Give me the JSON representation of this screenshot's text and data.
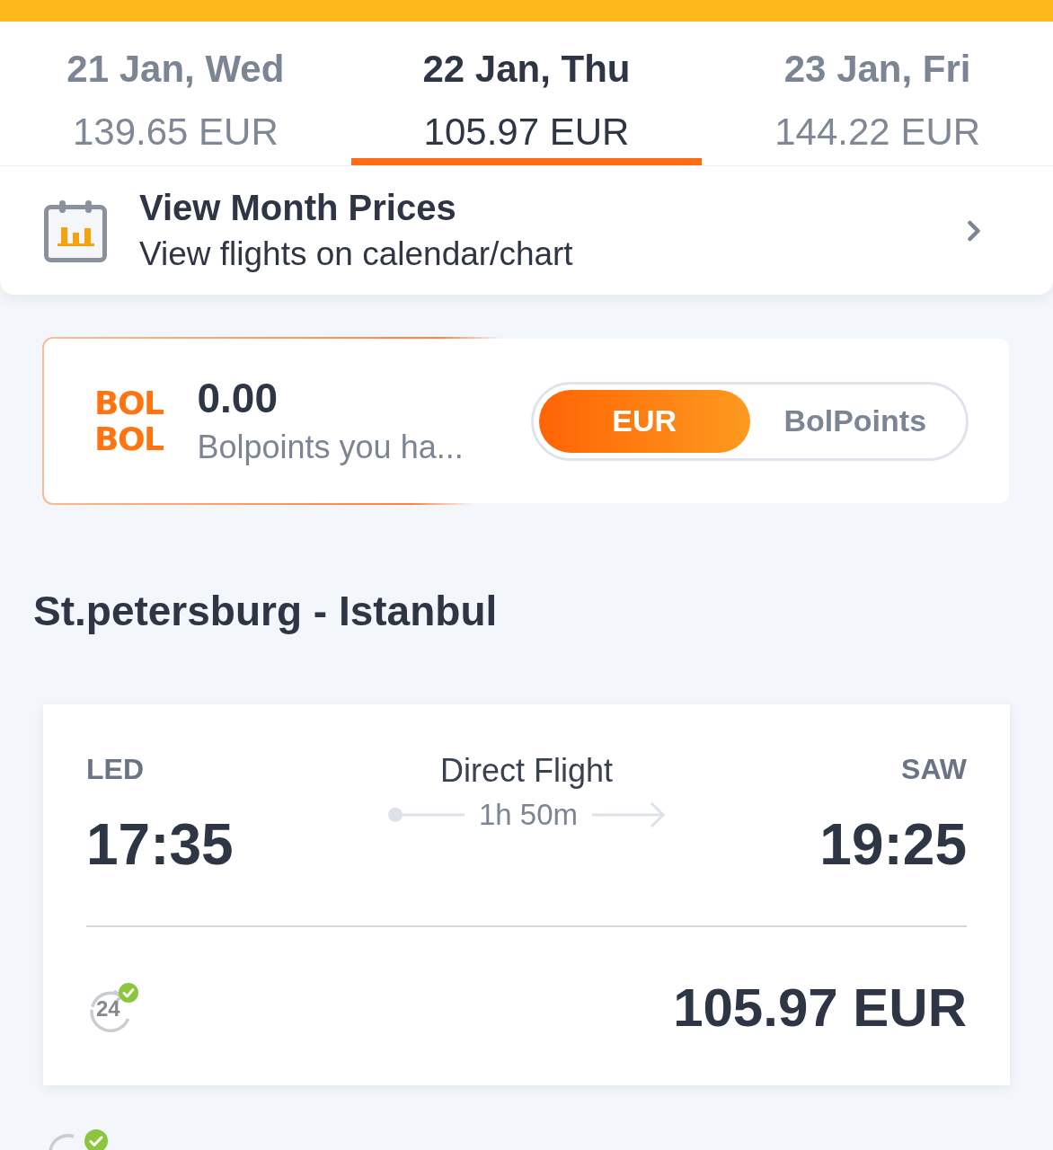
{
  "date_tabs": [
    {
      "date": "21 Jan, Wed",
      "price": "139.65 EUR",
      "selected": false
    },
    {
      "date": "22 Jan, Thu",
      "price": "105.97 EUR",
      "selected": true
    },
    {
      "date": "23 Jan, Fri",
      "price": "144.22 EUR",
      "selected": false
    }
  ],
  "month_prices": {
    "title": "View Month Prices",
    "subtitle": "View flights on calendar/chart"
  },
  "bolpoints": {
    "logo_lines": [
      "BOL",
      "BOL"
    ],
    "balance": "0.00",
    "caption": "Bolpoints you ha...",
    "currency_toggle": [
      {
        "label": "EUR",
        "selected": true
      },
      {
        "label": "BolPoints",
        "selected": false
      }
    ]
  },
  "route_title": "St.petersburg - Istanbul",
  "flights": [
    {
      "from_code": "LED",
      "departure": "17:35",
      "flight_type": "Direct Flight",
      "duration": "1h 50m",
      "to_code": "SAW",
      "arrival": "19:25",
      "badge_text": "24",
      "price": "105.97 EUR"
    }
  ]
}
